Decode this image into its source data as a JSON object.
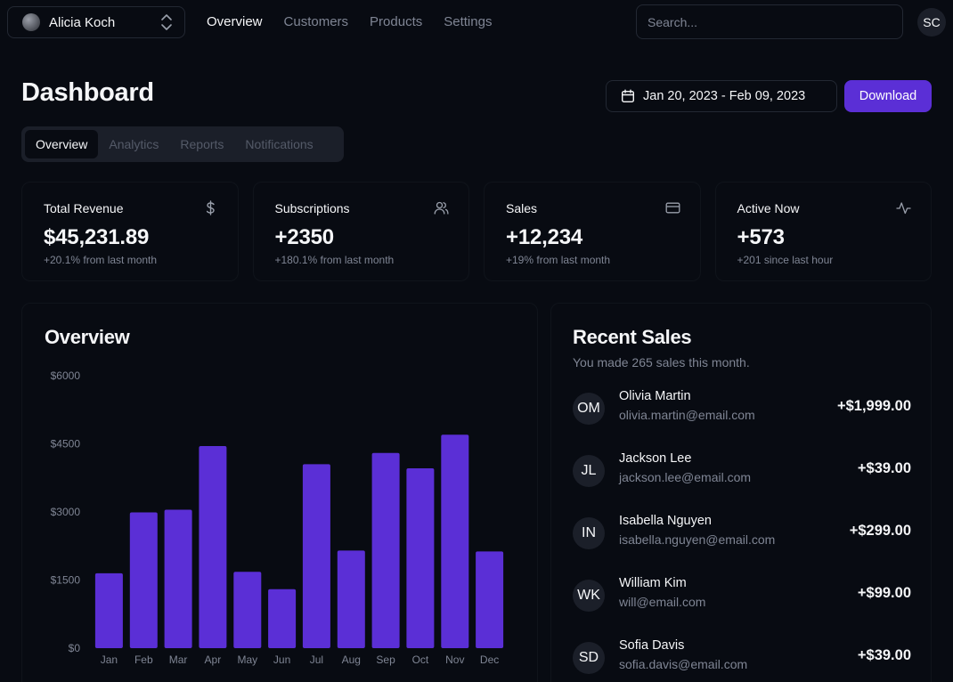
{
  "team": {
    "name": "Alicia Koch"
  },
  "nav": {
    "items": [
      {
        "label": "Overview",
        "active": true
      },
      {
        "label": "Customers",
        "active": false
      },
      {
        "label": "Products",
        "active": false
      },
      {
        "label": "Settings",
        "active": false
      }
    ]
  },
  "search": {
    "placeholder": "Search...",
    "value": ""
  },
  "user": {
    "initials": "SC"
  },
  "page": {
    "title": "Dashboard"
  },
  "date_range": {
    "label": "Jan 20, 2023 - Feb 09, 2023"
  },
  "download": {
    "label": "Download"
  },
  "tabs": [
    {
      "label": "Overview",
      "active": true
    },
    {
      "label": "Analytics",
      "active": false
    },
    {
      "label": "Reports",
      "active": false
    },
    {
      "label": "Notifications",
      "active": false
    }
  ],
  "stats": [
    {
      "label": "Total Revenue",
      "value": "$45,231.89",
      "sub": "+20.1% from last month",
      "icon": "dollar-icon"
    },
    {
      "label": "Subscriptions",
      "value": "+2350",
      "sub": "+180.1% from last month",
      "icon": "users-icon"
    },
    {
      "label": "Sales",
      "value": "+12,234",
      "sub": "+19% from last month",
      "icon": "credit-card-icon"
    },
    {
      "label": "Active Now",
      "value": "+573",
      "sub": "+201 since last hour",
      "icon": "activity-icon"
    }
  ],
  "overview": {
    "title": "Overview"
  },
  "chart_data": {
    "type": "bar",
    "categories": [
      "Jan",
      "Feb",
      "Mar",
      "Apr",
      "May",
      "Jun",
      "Jul",
      "Aug",
      "Sep",
      "Oct",
      "Nov",
      "Dec"
    ],
    "values": [
      1650,
      2990,
      3050,
      4450,
      1680,
      1300,
      4050,
      2150,
      4300,
      3960,
      4700,
      2130
    ],
    "ylim": [
      0,
      6000
    ],
    "yticks": [
      "$0",
      "$1500",
      "$3000",
      "$4500",
      "$6000"
    ],
    "ytick_values": [
      0,
      1500,
      3000,
      4500,
      6000
    ],
    "bar_color": "#5b2fd6",
    "grid": false,
    "title": "Overview"
  },
  "recent_sales": {
    "title": "Recent Sales",
    "subtitle": "You made 265 sales this month.",
    "items": [
      {
        "initials": "OM",
        "name": "Olivia Martin",
        "email": "olivia.martin@email.com",
        "amount": "+$1,999.00"
      },
      {
        "initials": "JL",
        "name": "Jackson Lee",
        "email": "jackson.lee@email.com",
        "amount": "+$39.00"
      },
      {
        "initials": "IN",
        "name": "Isabella Nguyen",
        "email": "isabella.nguyen@email.com",
        "amount": "+$299.00"
      },
      {
        "initials": "WK",
        "name": "William Kim",
        "email": "will@email.com",
        "amount": "+$99.00"
      },
      {
        "initials": "SD",
        "name": "Sofia Davis",
        "email": "sofia.davis@email.com",
        "amount": "+$39.00"
      }
    ]
  },
  "colors": {
    "background": "#080b12",
    "accent": "#5b2fd6",
    "muted_text": "#7f8594",
    "surface": "#1b1f29"
  }
}
